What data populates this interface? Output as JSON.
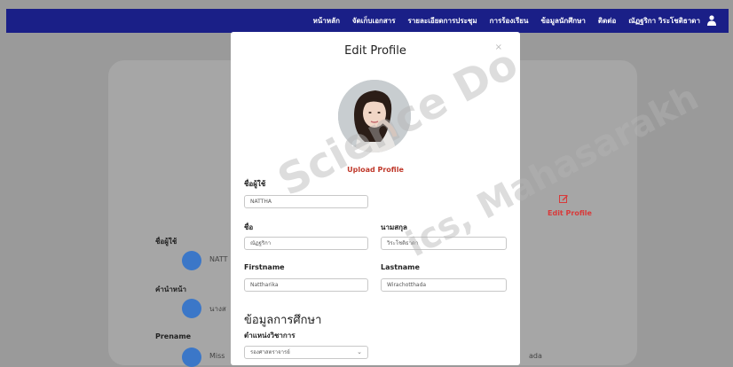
{
  "nav": {
    "items": [
      "หน้าหลัก",
      "จัดเก็บเอกสาร",
      "รายละเอียดการประชุม",
      "การร้องเรียน",
      "ข้อมูลนักศึกษา",
      "ติดต่อ",
      "ณัฏฐริกา วิระโชติธาดา"
    ],
    "user_icon": "user-icon"
  },
  "background": {
    "edit_label": "Edit Profile",
    "labels": [
      "ชื่อผู้ใช้",
      "คำนำหน้า",
      "Prename"
    ],
    "values": [
      "NATT",
      "นางส",
      "Miss",
      "ada"
    ]
  },
  "modal": {
    "title": "Edit Profile",
    "close": "×",
    "upload": "Upload Profile",
    "username_label": "ชื่อผู้ใช้",
    "username_value": "NATTHA",
    "first_th_label": "ชื่อ",
    "first_th_value": "ณัฏฐริกา",
    "last_th_label": "นามสกุล",
    "last_th_value": "วิระโชติธาดา",
    "first_en_label": "Firstname",
    "first_en_value": "Nattharika",
    "last_en_label": "Lastname",
    "last_en_value": "Wirachotthada",
    "section_title": "ข้อมูลการศึกษา",
    "position_label": "ตำแหน่งวิชาการ",
    "position_value": "รองศาสตราจารย์"
  },
  "watermark": {
    "texts": [
      "Science Do",
      "ics, Mahasarakh"
    ]
  }
}
